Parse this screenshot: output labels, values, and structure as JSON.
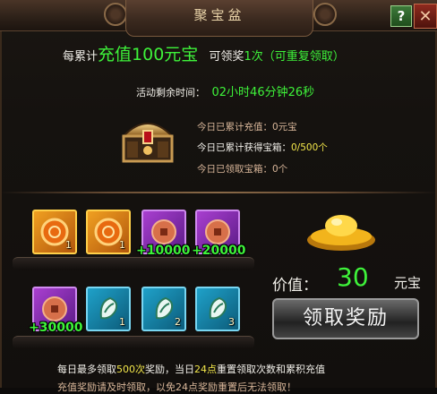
{
  "window": {
    "title": "聚宝盆"
  },
  "header": {
    "prefix": "每累计",
    "highlight": "充值100元宝",
    "mid": "可领奖",
    "count": "1次",
    "suffix": "（可重复领取）"
  },
  "timer": {
    "label": "活动剩余时间：",
    "value": "02小时46分钟26秒"
  },
  "stats": {
    "today_recharge": "今日已累计充值：0元宝",
    "boxes_label": "今日已累计获得宝箱：",
    "boxes_value": "0/500个",
    "claimed": "今日已领取宝箱：0个"
  },
  "items_row1": [
    {
      "style": "orange",
      "count": "1",
      "icon": "gold-coin-icon"
    },
    {
      "style": "orange",
      "count": "1",
      "icon": "gold-coin-icon"
    },
    {
      "style": "purple",
      "count": "",
      "icon": "copper-coin-icon",
      "bonus": "+10000"
    },
    {
      "style": "purple",
      "count": "",
      "icon": "copper-coin-icon",
      "bonus": "+20000"
    }
  ],
  "items_row2": [
    {
      "style": "purple",
      "count": "",
      "icon": "copper-coin-icon",
      "bonus": "+30000"
    },
    {
      "style": "teal",
      "count": "1",
      "icon": "jade-scroll-icon"
    },
    {
      "style": "teal",
      "count": "2",
      "icon": "jade-scroll-icon"
    },
    {
      "style": "teal",
      "count": "3",
      "icon": "jade-scroll-icon"
    }
  ],
  "value": {
    "label": "价值：",
    "amount": "30",
    "unit": "元宝"
  },
  "claim_button": "领取奖励",
  "footer": {
    "line1_a": "每日最多领取",
    "line1_b": "500次",
    "line1_c": "奖励，当日",
    "line1_d": "24点",
    "line1_e": "重置领取次数和累积充值",
    "line2": "充值奖励请及时领取，以免24点奖励重置后无法领取！"
  },
  "colors": {
    "accent_green": "#3ef23a",
    "accent_yellow": "#f2e64a"
  }
}
